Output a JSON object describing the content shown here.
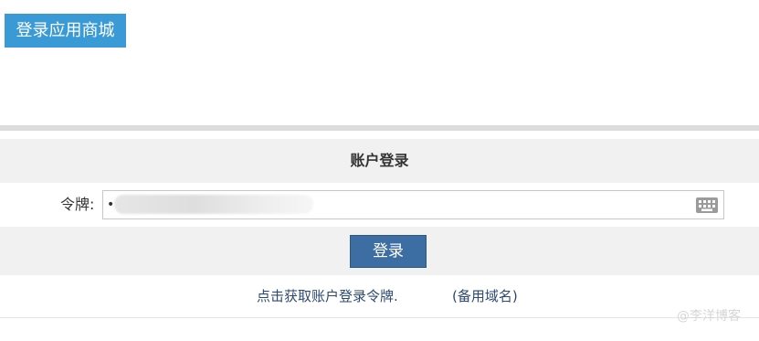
{
  "header": {
    "store_button_label": "登录应用商城"
  },
  "login_panel": {
    "title": "账户登录",
    "token_label": "令牌:",
    "token_value": "•",
    "login_button_label": "登录",
    "get_token_link": "点击获取账户登录令牌.",
    "backup_domain_link": "(备用域名)"
  },
  "watermark": "@李洋博客",
  "icons": {
    "keyboard": "keyboard-icon"
  },
  "colors": {
    "store_button_bg": "#3a9ad6",
    "login_button_bg": "#3c6ea3",
    "link_color": "#2d4a73",
    "panel_row_bg": "#f1f1f1"
  }
}
